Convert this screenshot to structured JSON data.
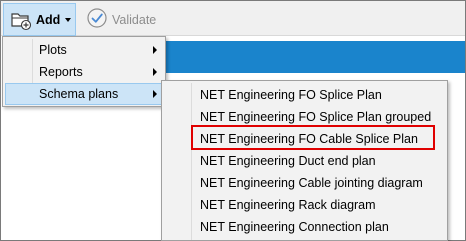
{
  "toolbar": {
    "add_label": "Add",
    "validate_label": "Validate"
  },
  "menu": {
    "items": [
      {
        "label": "Plots",
        "has_submenu": true
      },
      {
        "label": "Reports",
        "has_submenu": true
      },
      {
        "label": "Schema plans",
        "has_submenu": true
      }
    ]
  },
  "submenu": {
    "items": [
      {
        "label": "NET Engineering FO Splice Plan"
      },
      {
        "label": "NET Engineering FO Splice Plan grouped"
      },
      {
        "label": "NET Engineering FO Cable Splice Plan"
      },
      {
        "label": "NET Engineering Duct end plan"
      },
      {
        "label": "NET Engineering Cable jointing diagram"
      },
      {
        "label": "NET Engineering Rack diagram"
      },
      {
        "label": "NET Engineering Connection plan"
      }
    ]
  },
  "colors": {
    "highlight_fill": "#cce4f7",
    "highlight_border": "#99c9ef",
    "blue_bar": "#1a84cc",
    "callout_outline": "#e00000",
    "disabled_text": "#8d8d8d"
  }
}
